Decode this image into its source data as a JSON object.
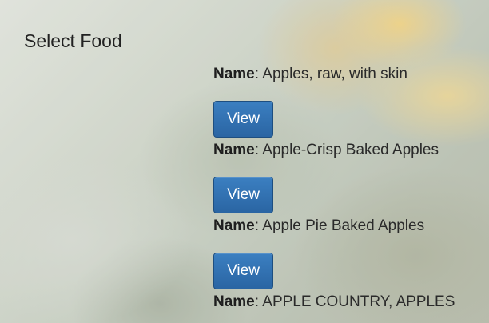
{
  "page": {
    "title": "Select Food"
  },
  "results": {
    "name_label": "Name",
    "separator": ":",
    "button_label": "View",
    "items": [
      {
        "name": "Apples, raw, with skin"
      },
      {
        "name": "Apple-Crisp Baked Apples"
      },
      {
        "name": "Apple Pie Baked Apples"
      },
      {
        "name": "APPLE COUNTRY, APPLES"
      }
    ]
  }
}
